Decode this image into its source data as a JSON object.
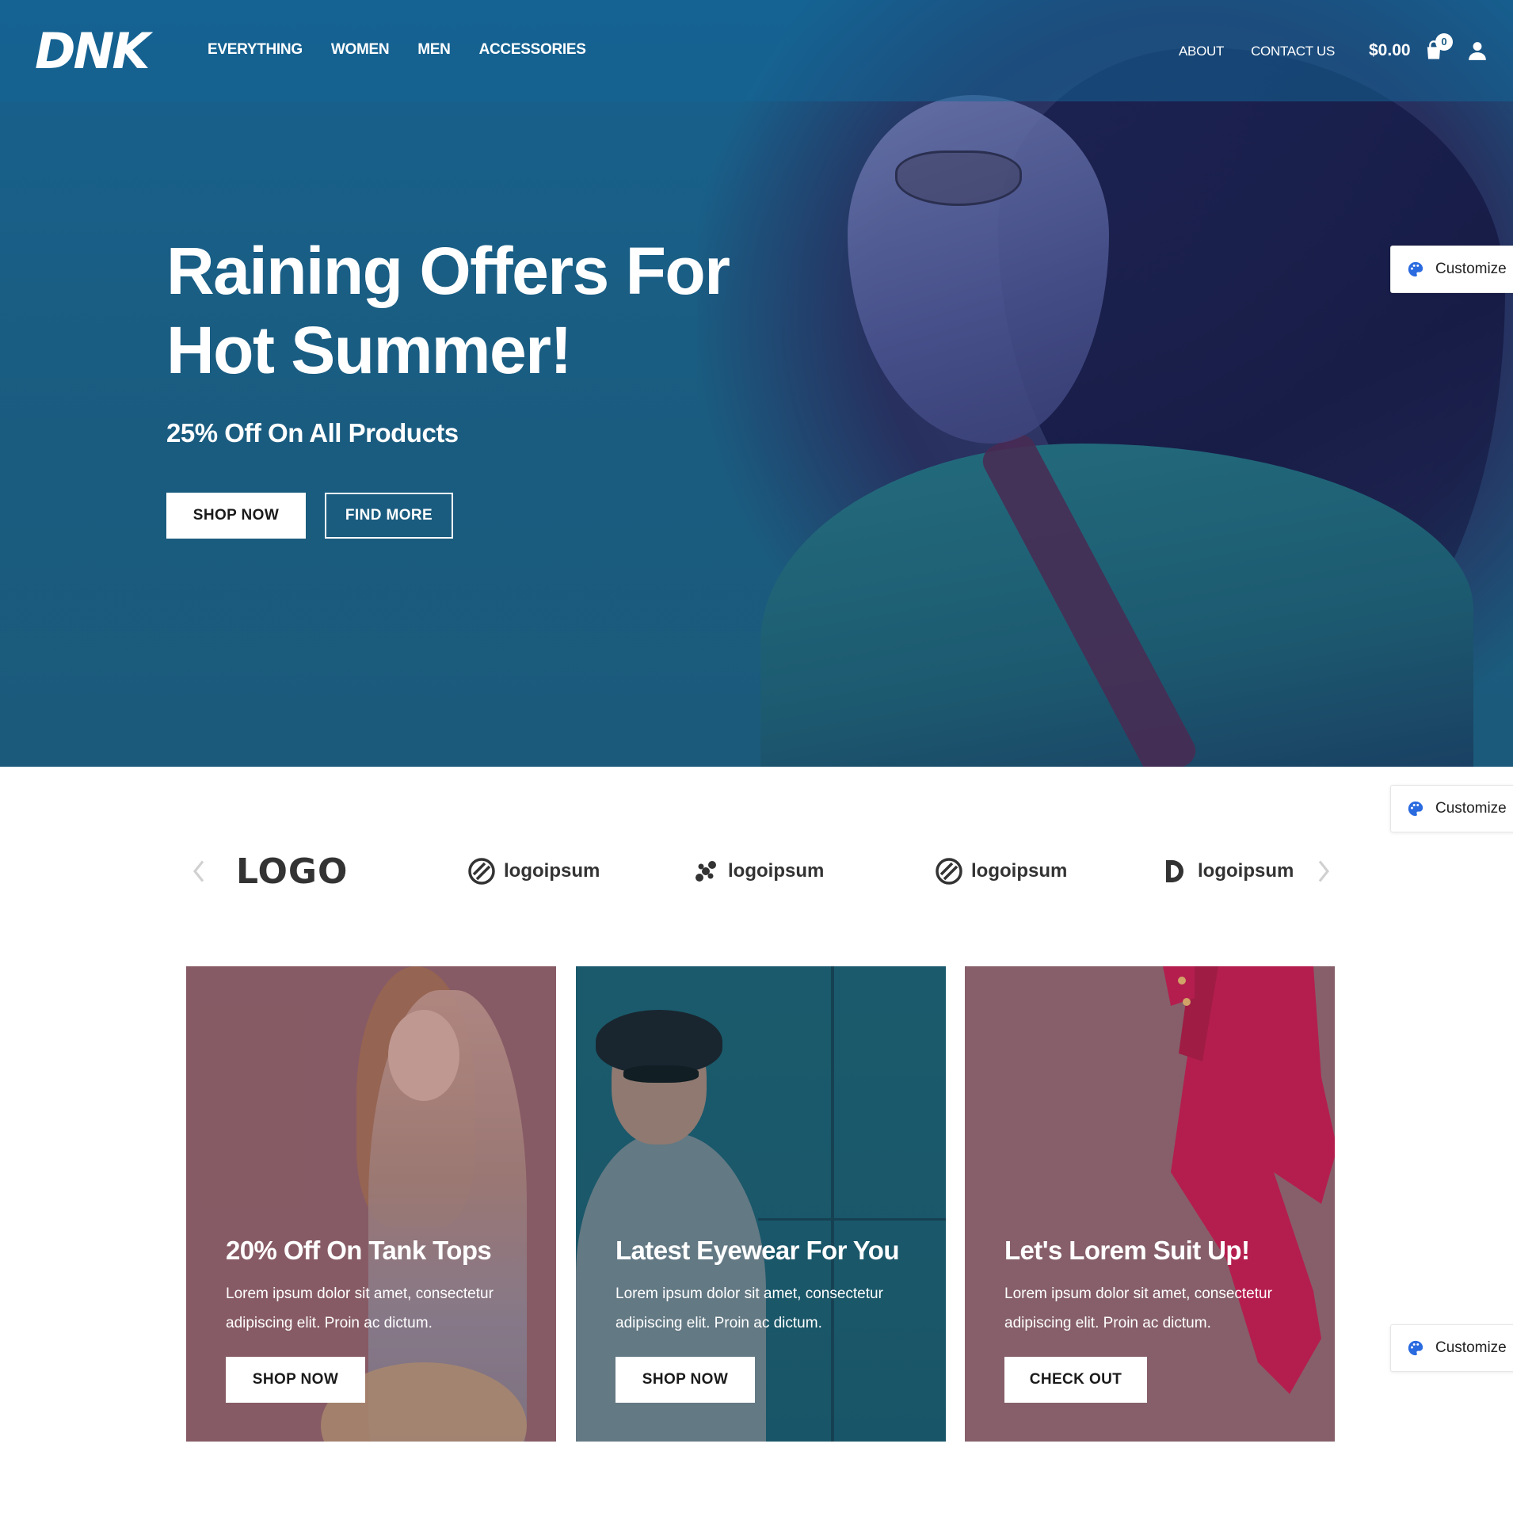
{
  "brand": {
    "logo_text": "DNK"
  },
  "nav": {
    "left": [
      "EVERYTHING",
      "WOMEN",
      "MEN",
      "ACCESSORIES"
    ],
    "right": [
      "ABOUT",
      "CONTACT US"
    ],
    "cart_total": "$0.00",
    "cart_count": "0"
  },
  "hero": {
    "title": "Raining Offers For Hot Summer!",
    "subtitle": "25% Off On All Products",
    "primary_button": "SHOP NOW",
    "secondary_button": "FIND MORE"
  },
  "customize": {
    "label": "Customize"
  },
  "brands": {
    "items": [
      "LOGO",
      "logoipsum",
      "logoipsum",
      "logoipsum",
      "logoipsum"
    ]
  },
  "cards": [
    {
      "title": "20% Off On Tank Tops",
      "text": "Lorem ipsum dolor sit amet, consectetur adipiscing elit. Proin ac dictum.",
      "button": "SHOP NOW"
    },
    {
      "title": "Latest Eyewear For You",
      "text": "Lorem ipsum dolor sit amet, consectetur adipiscing elit. Proin ac dictum.",
      "button": "SHOP NOW"
    },
    {
      "title": "Let's Lorem Suit Up!",
      "text": "Lorem ipsum dolor sit amet, consectetur adipiscing elit. Proin ac dictum.",
      "button": "CHECK OUT"
    }
  ],
  "colors": {
    "hero_blue": "#17628f",
    "card_mauve": "#8a626b",
    "card_teal": "#1d6172",
    "icon_blue": "#2b6be0"
  }
}
